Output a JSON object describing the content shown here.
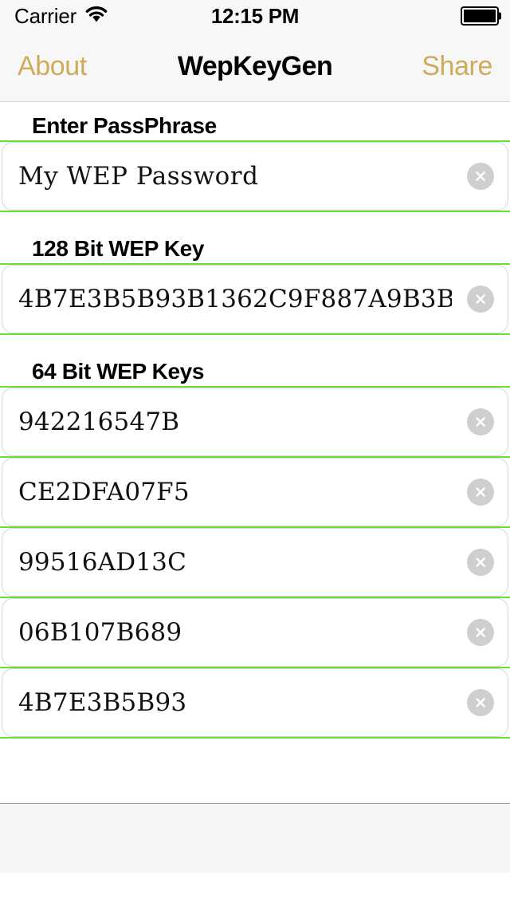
{
  "status_bar": {
    "carrier": "Carrier",
    "wifi_icon": "wifi-icon",
    "time": "12:15 PM",
    "battery_icon": "battery-full-icon"
  },
  "nav_bar": {
    "left_button": "About",
    "title": "WepKeyGen",
    "right_button": "Share",
    "tint_color": "#cdab5a"
  },
  "theme": {
    "separator_green": "#66e032",
    "field_border": "#d6d6d6",
    "clear_button_gray": "#cfcfcf"
  },
  "sections": [
    {
      "label": "Enter PassPhrase",
      "fields": [
        {
          "value": "My WEP Password",
          "clear_icon": "clear-circle-icon"
        }
      ]
    },
    {
      "label": "128 Bit WEP Key",
      "fields": [
        {
          "value": "4B7E3B5B93B1362C9F887A9B3B",
          "clear_icon": "clear-circle-icon"
        }
      ]
    },
    {
      "label": "64 Bit WEP Keys",
      "fields": [
        {
          "value": "942216547B",
          "clear_icon": "clear-circle-icon"
        },
        {
          "value": "CE2DFA07F5",
          "clear_icon": "clear-circle-icon"
        },
        {
          "value": "99516AD13C",
          "clear_icon": "clear-circle-icon"
        },
        {
          "value": "06B107B689",
          "clear_icon": "clear-circle-icon"
        },
        {
          "value": "4B7E3B5B93",
          "clear_icon": "clear-circle-icon"
        }
      ]
    }
  ]
}
